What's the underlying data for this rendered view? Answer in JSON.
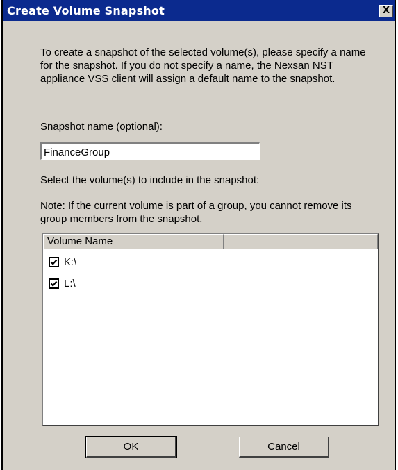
{
  "window": {
    "title": "Create Volume Snapshot",
    "close_label": "X"
  },
  "intro_text": "To create a snapshot of the selected volume(s), please specify a name for the snapshot. If you do not specify a name, the Nexsan NST appliance VSS client will assign a default name to the snapshot.",
  "snapshot_name": {
    "label": "Snapshot name (optional):",
    "value": "FinanceGroup"
  },
  "select_label": "Select the volume(s) to include in the snapshot:",
  "note_text": "Note: If the current volume is part of a group, you cannot remove its group members from the snapshot.",
  "volume_list": {
    "columns": [
      "Volume Name",
      ""
    ],
    "rows": [
      {
        "label": "K:\\",
        "checked": true
      },
      {
        "label": "L:\\",
        "checked": true
      }
    ]
  },
  "buttons": {
    "ok": "OK",
    "cancel": "Cancel"
  },
  "colors": {
    "titlebar": "#0b2a8e",
    "dialog_bg": "#d4d0c8"
  }
}
